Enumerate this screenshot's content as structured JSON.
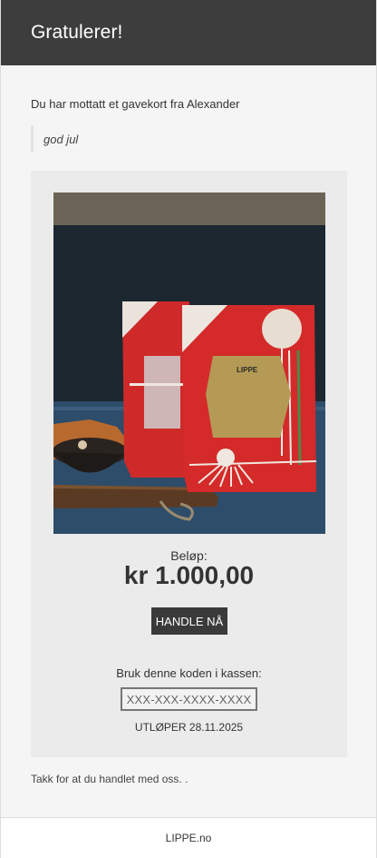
{
  "header": {
    "title": "Gratulerer!"
  },
  "message": {
    "intro": "Du har mottatt et gavekort fra Alexander",
    "note": "god jul"
  },
  "card": {
    "image_brand": "LIPPE",
    "amount_label": "Beløp:",
    "amount": "kr 1.000,00",
    "shop_button": "HANDLE NÅ",
    "code_label": "Bruk denne koden i kassen:",
    "code": "XXX-XXX-XXXX-XXXX",
    "expiry": "UTLØPER 28.11.2025"
  },
  "closing": {
    "thanks": "Takk for at du handlet med oss. ."
  },
  "footer": {
    "link": "LIPPE.no"
  },
  "colors": {
    "header_bg": "#3d3d3d",
    "card_bg": "#ebebeb",
    "button_bg": "#3a3a3a",
    "bag_red": "#d42a2a"
  }
}
